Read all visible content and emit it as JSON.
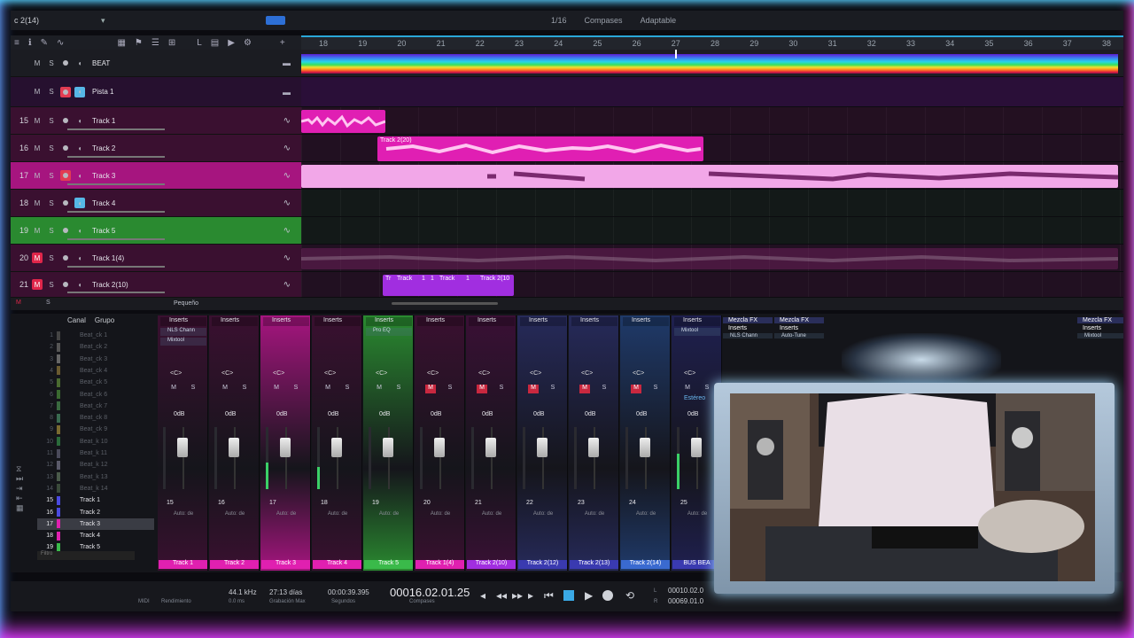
{
  "colors": {
    "accent": "#2aa7d8",
    "pink": "#e91fb6",
    "magenta": "#c61a9e",
    "green": "#3bbd4a",
    "purple": "#8a2be2",
    "mute_red": "#e0264a"
  },
  "topbar": {
    "song": "c 2(14)",
    "snap": "1/16",
    "timebase": "Compases",
    "snap_mode": "Adaptable"
  },
  "ruler": {
    "bars": [
      "18",
      "19",
      "20",
      "21",
      "22",
      "23",
      "24",
      "25",
      "26",
      "27",
      "28",
      "29",
      "30",
      "31",
      "32",
      "33",
      "34",
      "35",
      "36",
      "37",
      "38"
    ]
  },
  "track_buttons": {
    "mute": "M",
    "solo": "S"
  },
  "tracks": [
    {
      "num": "",
      "name": "BEAT"
    },
    {
      "num": "",
      "name": "Pista 1"
    },
    {
      "num": "15",
      "name": "Track 1"
    },
    {
      "num": "16",
      "name": "Track 2"
    },
    {
      "num": "17",
      "name": "Track 3"
    },
    {
      "num": "18",
      "name": "Track 4"
    },
    {
      "num": "19",
      "name": "Track 5"
    },
    {
      "num": "20",
      "name": "Track 1(4)"
    },
    {
      "num": "21",
      "name": "Track 2(10)"
    }
  ],
  "clips": {
    "track2": "Track 2(20)",
    "track21_a": "Tr",
    "track21_b": "Track",
    "track21_c": "1",
    "track21_d": "1",
    "track21_e": "Track",
    "track21_f": "1",
    "track21_g": "Track 2(10"
  },
  "scroll_label": "Pequeño",
  "mixer": {
    "col_canal": "Canal",
    "col_grupo": "Grupo",
    "channels": [
      {
        "n": "1",
        "t": "Beat_ck 1"
      },
      {
        "n": "2",
        "t": "Beat_ck 2"
      },
      {
        "n": "3",
        "t": "Beat_ck 3"
      },
      {
        "n": "4",
        "t": "Beat_ck 4"
      },
      {
        "n": "5",
        "t": "Beat_ck 5"
      },
      {
        "n": "6",
        "t": "Beat_ck 6"
      },
      {
        "n": "7",
        "t": "Beat_ck 7"
      },
      {
        "n": "8",
        "t": "Beat_ck 8"
      },
      {
        "n": "9",
        "t": "Beat_ck 9"
      },
      {
        "n": "10",
        "t": "Beat_k 10"
      },
      {
        "n": "11",
        "t": "Beat_k 11"
      },
      {
        "n": "12",
        "t": "Beat_k 12"
      },
      {
        "n": "13",
        "t": "Beat_k 13"
      },
      {
        "n": "14",
        "t": "Beat_k 14"
      },
      {
        "n": "15",
        "t": "Track 1"
      },
      {
        "n": "16",
        "t": "Track 2"
      },
      {
        "n": "17",
        "t": "Track 3"
      },
      {
        "n": "18",
        "t": "Track 4"
      },
      {
        "n": "19",
        "t": "Track 5"
      }
    ],
    "filter_placeholder": "Filtro",
    "inserts_label": "Inserts",
    "fx_label": "Mezcla FX",
    "pan_label": "<C>",
    "auto_label": "Auto: de",
    "strips": [
      {
        "num": "15",
        "name": "Track 1",
        "plug1": "NLS Chann",
        "plug2": "Mixtool",
        "db": "0dB"
      },
      {
        "num": "16",
        "name": "Track 2",
        "plug1": "",
        "plug2": "",
        "db": "0dB"
      },
      {
        "num": "17",
        "name": "Track 3",
        "plug1": "",
        "plug2": "",
        "db": "0dB"
      },
      {
        "num": "18",
        "name": "Track 4",
        "plug1": "",
        "plug2": "",
        "db": "0dB"
      },
      {
        "num": "19",
        "name": "Track 5",
        "plug1": "Pro EQ",
        "plug2": "",
        "db": "0dB"
      },
      {
        "num": "20",
        "name": "Track 1(4)",
        "plug1": "",
        "plug2": "",
        "db": "0dB"
      },
      {
        "num": "21",
        "name": "Track 2(10)",
        "plug1": "",
        "plug2": "",
        "db": "0dB"
      },
      {
        "num": "22",
        "name": "Track 2(12)",
        "plug1": "",
        "plug2": "",
        "db": "0dB"
      },
      {
        "num": "23",
        "name": "Track 2(13)",
        "plug1": "",
        "plug2": "",
        "db": "0dB"
      },
      {
        "num": "24",
        "name": "Track 2(14)",
        "plug1": "",
        "plug2": "",
        "db": "0dB"
      },
      {
        "num": "25",
        "name": "BUS BEA",
        "plug1": "Mixtool",
        "plug2": "",
        "db": "0dB"
      }
    ],
    "fx_strips": [
      {
        "plug": "NLS Chann"
      },
      {
        "plug": "Auto-Tune"
      }
    ],
    "right_fx": {
      "plug": "Mixtool"
    },
    "stereo_label": "Estéreo"
  },
  "transport": {
    "midi": "MIDI",
    "perf": "Rendimiento",
    "rate": "44.1 kHz",
    "latency": "0.0 ms",
    "rec_days": "27:13 días",
    "rec_max": "Grabación Max",
    "seconds": "00:00:39.395",
    "seconds_label": "Segundos",
    "bars": "00016.02.01.25",
    "bars_label": "Compases",
    "loop_start": "00010.02.0",
    "loop_end": "00069.01.0",
    "loop_l": "L",
    "loop_r": "R"
  }
}
